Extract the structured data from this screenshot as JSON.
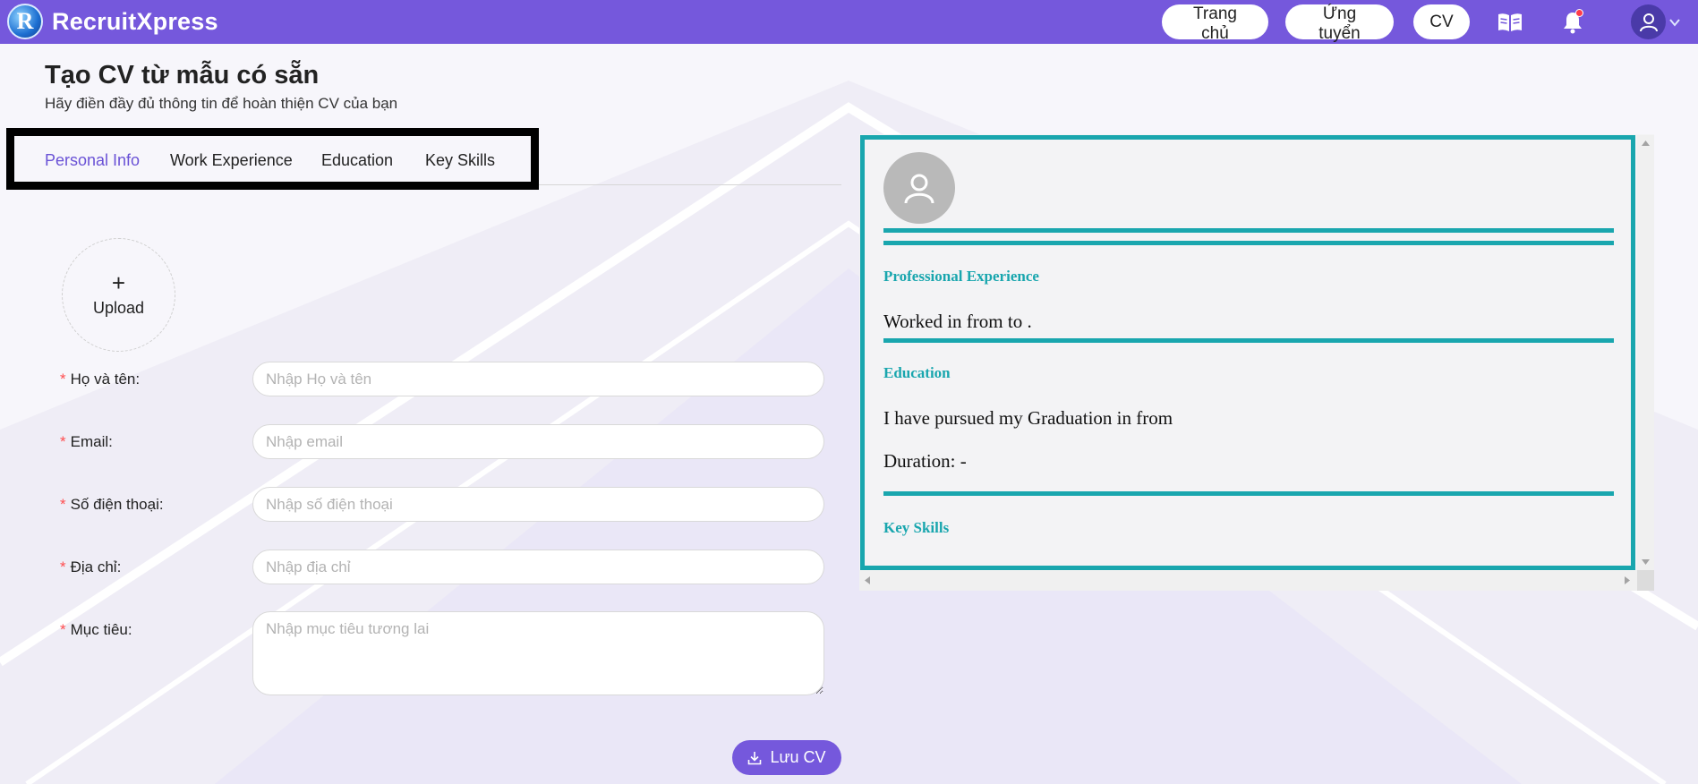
{
  "header": {
    "brand_name": "RecruitXpress",
    "brand_logo_letter": "R",
    "nav": {
      "home": "Trang chủ",
      "apply": "Ứng tuyển",
      "cv": "CV"
    },
    "icons": [
      "book-open-icon",
      "bell-icon",
      "user-icon",
      "chevron-down-icon"
    ],
    "has_notification": true
  },
  "page": {
    "title": "Tạo CV từ mẫu có sẵn",
    "subtitle": "Hãy điền đầy đủ thông tin để hoàn thiện CV của bạn"
  },
  "tabs": {
    "items": [
      "Personal Info",
      "Work Experience",
      "Education",
      "Key Skills"
    ],
    "active": "Personal Info"
  },
  "form": {
    "upload": {
      "plus": "+",
      "label": "Upload"
    },
    "required_mark": "*",
    "fields": {
      "name": {
        "label": "Họ và tên",
        "placeholder": "Nhập Họ và tên",
        "value": ""
      },
      "email": {
        "label": "Email",
        "placeholder": "Nhập email",
        "value": ""
      },
      "phone": {
        "label": "Số điện thoại",
        "placeholder": "Nhập số điện thoại",
        "value": ""
      },
      "address": {
        "label": "Địa chỉ",
        "placeholder": "Nhập địa chỉ",
        "value": ""
      },
      "objective": {
        "label": "Mục tiêu",
        "placeholder": "Nhập mục tiêu tương lai",
        "value": ""
      }
    },
    "label_suffix": ":",
    "save_label": "Lưu CV"
  },
  "preview": {
    "experience_heading": "Professional Experience",
    "experience_text": "Worked in from to .",
    "education_heading": "Education",
    "education_text": "I have pursued my Graduation in from",
    "duration_text": "Duration: -",
    "skills_heading": "Key Skills"
  },
  "colors": {
    "brand": "#7558dc",
    "active_tab": "#6a52d6",
    "preview_accent": "#19a6ae",
    "required": "#ff4d4f"
  }
}
